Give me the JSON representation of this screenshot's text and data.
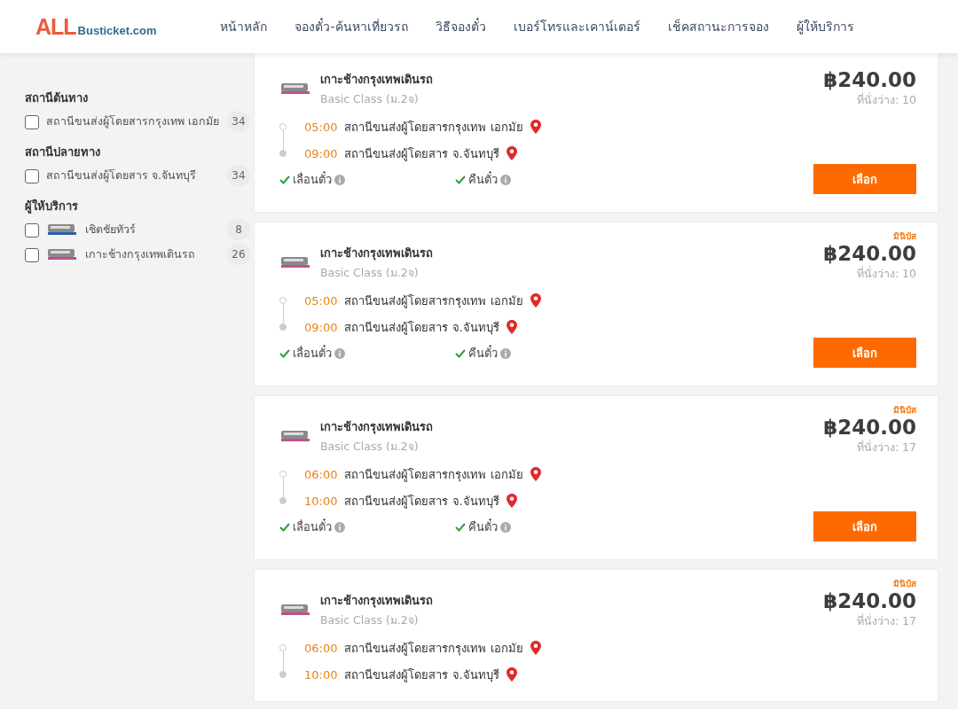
{
  "header": {
    "logo": {
      "brand": "ALL",
      "domain": "Busticket.com"
    },
    "nav": [
      "หน้าหลัก",
      "จองตั๋ว-ค้นหาเที่ยวรถ",
      "วิธีจองตั๋ว",
      "เบอร์โทรและเคาน์เตอร์",
      "เช็คสถานะการจอง",
      "ผู้ให้บริการ"
    ]
  },
  "filters": [
    {
      "title": "สถานีต้นทาง",
      "options": [
        {
          "kind": "plain",
          "label": "สถานีขนส่งผู้โดยสารกรุงเทพ เอกมัย",
          "count": "34",
          "checked": false
        }
      ]
    },
    {
      "title": "สถานีปลายทาง",
      "options": [
        {
          "kind": "plain",
          "label": "สถานีขนส่งผู้โดยสาร จ.จันทบุรี",
          "count": "34",
          "checked": false
        }
      ]
    },
    {
      "title": "ผู้ให้บริการ",
      "options": [
        {
          "kind": "provider",
          "label": "เชิดชัยทัวร์",
          "count": "8",
          "checked": false,
          "color": "#2a5fb0"
        },
        {
          "kind": "provider",
          "label": "เกาะช้างกรุงเทพเดินรถ",
          "count": "26",
          "checked": false,
          "color": "#c0508a"
        }
      ]
    }
  ],
  "trips": [
    {
      "operator": "เกาะช้างกรุงเทพเดินรถ",
      "class": "Basic Class (ม.2จ)",
      "price": "฿240.00",
      "seats": "ที่นั่งว่าง: 10",
      "stops": [
        {
          "time": "05:00",
          "station": "สถานีขนส่งผู้โดยสารกรุงเทพ เอกมัย"
        },
        {
          "time": "09:00",
          "station": "สถานีขนส่งผู้โดยสาร จ.จันทบุรี"
        }
      ],
      "features": [
        {
          "label": "เลื่อนตั๋ว",
          "available": true
        },
        {
          "label": "คืนตั๋ว",
          "available": true
        }
      ],
      "button": "เลือก"
    },
    {
      "badge": "มินิบัส",
      "operator": "เกาะช้างกรุงเทพเดินรถ",
      "class": "Basic Class (ม.2จ)",
      "price": "฿240.00",
      "seats": "ที่นั่งว่าง: 10",
      "stops": [
        {
          "time": "05:00",
          "station": "สถานีขนส่งผู้โดยสารกรุงเทพ เอกมัย"
        },
        {
          "time": "09:00",
          "station": "สถานีขนส่งผู้โดยสาร จ.จันทบุรี"
        }
      ],
      "features": [
        {
          "label": "เลื่อนตั๋ว",
          "available": true
        },
        {
          "label": "คืนตั๋ว",
          "available": true
        }
      ],
      "button": "เลือก"
    },
    {
      "badge": "มินิบัส",
      "operator": "เกาะช้างกรุงเทพเดินรถ",
      "class": "Basic Class (ม.2จ)",
      "price": "฿240.00",
      "seats": "ที่นั่งว่าง: 17",
      "stops": [
        {
          "time": "06:00",
          "station": "สถานีขนส่งผู้โดยสารกรุงเทพ เอกมัย"
        },
        {
          "time": "10:00",
          "station": "สถานีขนส่งผู้โดยสาร จ.จันทบุรี"
        }
      ],
      "features": [
        {
          "label": "เลื่อนตั๋ว",
          "available": true
        },
        {
          "label": "คืนตั๋ว",
          "available": true
        }
      ],
      "button": "เลือก"
    },
    {
      "badge": "มินิบัส",
      "operator": "เกาะช้างกรุงเทพเดินรถ",
      "class": "Basic Class (ม.2จ)",
      "price": "฿240.00",
      "seats": "ที่นั่งว่าง: 17",
      "stops": [
        {
          "time": "06:00",
          "station": "สถานีขนส่งผู้โดยสารกรุงเทพ เอกมัย"
        },
        {
          "time": "10:00",
          "station": "สถานีขนส่งผู้โดยสาร จ.จันทบุรี"
        }
      ]
    }
  ]
}
